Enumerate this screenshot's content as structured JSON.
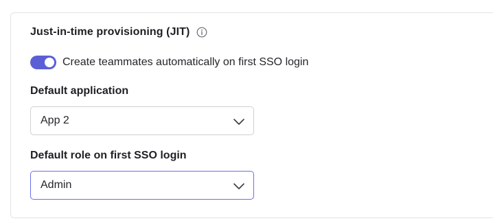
{
  "section": {
    "title": "Just-in-time provisioning (JIT)",
    "info_icon": "info-circle-icon"
  },
  "toggle": {
    "label": "Create teammates automatically on first SSO login",
    "state": "on",
    "color": "#5b5fd6"
  },
  "default_application": {
    "label": "Default application",
    "selected": "App 2"
  },
  "default_role": {
    "label": "Default role on first SSO login",
    "selected": "Admin",
    "focus_color": "#6a6ee8"
  }
}
